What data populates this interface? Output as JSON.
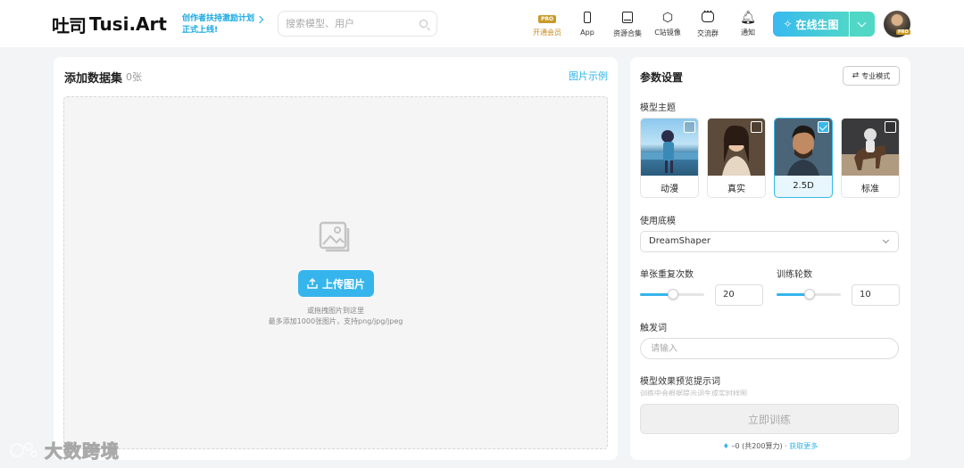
{
  "header": {
    "logo_cn": "吐司",
    "logo_en": "Tusi.Art",
    "promo_line1": "创作者扶持激励计划",
    "promo_line2": "正式上线!",
    "search_placeholder": "搜索模型、用户",
    "nav": [
      {
        "label": "开通会员",
        "badge": "PRO",
        "icon": "pro-badge-icon"
      },
      {
        "label": "App",
        "icon": "phone-icon"
      },
      {
        "label": "资源合集",
        "icon": "book-icon"
      },
      {
        "label": "C站镜像",
        "icon": "hexagon-c-icon"
      },
      {
        "label": "交流群",
        "icon": "chat-icon"
      },
      {
        "label": "通知",
        "icon": "bell-icon"
      }
    ],
    "generate_button": "在线生图",
    "avatar_badge": "PRO"
  },
  "dataset": {
    "title": "添加数据集",
    "count": "0张",
    "example_link": "图片示例",
    "upload_button": "上传图片",
    "hint_line1": "或拖拽图片到这里",
    "hint_line2": "最多添加1000张图片，支持png/jpg/jpeg"
  },
  "params": {
    "title": "参数设置",
    "pro_mode_button": "专业模式",
    "model_theme_label": "模型主题",
    "themes": [
      {
        "label": "动漫",
        "selected": false
      },
      {
        "label": "真实",
        "selected": false
      },
      {
        "label": "2.5D",
        "selected": true
      },
      {
        "label": "标准",
        "selected": false
      }
    ],
    "base_model_label": "使用底模",
    "base_model_value": "DreamShaper",
    "repeat_label": "单张重复次数",
    "repeat_value": "20",
    "epochs_label": "训练轮数",
    "epochs_value": "10",
    "trigger_label": "触发词",
    "trigger_placeholder": "请输入",
    "preview_prompt_label": "模型效果预览提示词",
    "preview_prompt_hint": "训练中会根据提示词生成实时样图",
    "train_button": "立即训练",
    "credits_text": "–0 (共200算力) ·",
    "credits_link": "获取更多"
  },
  "watermark": "大数跨境",
  "colors": {
    "accent": "#35b5ec",
    "gradient_end": "#50d7c6",
    "pro_gold": "#c99a2b"
  }
}
